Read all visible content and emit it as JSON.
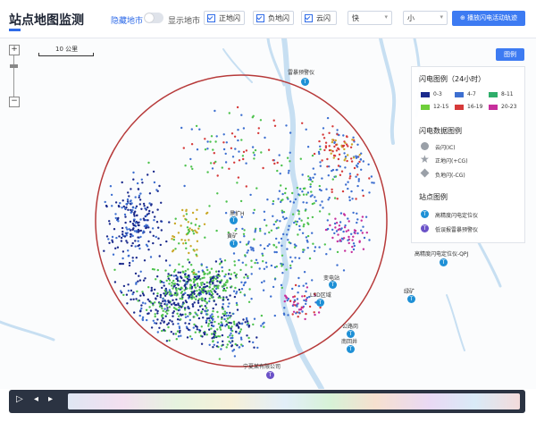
{
  "header": {
    "title": "站点地图监测",
    "hide_map_label": "隐藏地市",
    "show_map_label": "显示地市",
    "checkboxes": [
      {
        "label": "正地闪",
        "checked": true
      },
      {
        "label": "负地闪",
        "checked": true
      },
      {
        "label": "云闪",
        "checked": true
      }
    ],
    "select_speed": "快",
    "select_size": "小",
    "primary_button": "播放闪电活动轨迹"
  },
  "map": {
    "scale_label": "10 公里",
    "legend_button": "图例",
    "zoom_in": "+",
    "zoom_out": "−",
    "colors": {
      "circle": "#b73a3a",
      "navy": "#1b2a8c",
      "blue": "#3d6fd0",
      "green": "#4dc24d",
      "yellow": "#c9a827",
      "red": "#d63a3a",
      "magenta": "#c72f9c",
      "river": "#c7dff2"
    },
    "stations": [
      {
        "name": "雷暴预警仪",
        "pin": "T",
        "type": "blue"
      },
      {
        "name": "黑扩H",
        "pin": "T",
        "type": "blue"
      },
      {
        "name": "黄矿",
        "pin": "T",
        "type": "blue"
      },
      {
        "name": "变电站",
        "pin": "T",
        "type": "blue"
      },
      {
        "name": "LSD区域",
        "pin": "T",
        "type": "blue"
      },
      {
        "name": "公路岗",
        "pin": "T",
        "type": "blue"
      },
      {
        "name": "南回井",
        "pin": "T",
        "type": "blue"
      },
      {
        "name": "高精度闪电定位仪-QPJ",
        "pin": "T",
        "type": "blue"
      },
      {
        "name": "绿矿",
        "pin": "T",
        "type": "blue"
      },
      {
        "name": "宁夏某有限公司",
        "pin": "T",
        "type": "purple"
      }
    ]
  },
  "legend": {
    "title": "闪电图例（24小时）",
    "ranges": [
      {
        "label": "0-3",
        "color": "#1b2a8c"
      },
      {
        "label": "4-7",
        "color": "#3d6fd0"
      },
      {
        "label": "8-11",
        "color": "#2fae6a"
      },
      {
        "label": "12-15",
        "color": "#6fcf3a"
      },
      {
        "label": "16-19",
        "color": "#d63a3a"
      },
      {
        "label": "20-23",
        "color": "#c72f9c"
      }
    ],
    "data_title": "闪电数据图例",
    "data_items": [
      {
        "label": "云闪(IC)",
        "icon": "circle-icon"
      },
      {
        "label": "正地闪(+CG)",
        "icon": "star-icon"
      },
      {
        "label": "负地闪(-CG)",
        "icon": "diamond-icon"
      }
    ],
    "station_title": "站点图例",
    "station_items": [
      {
        "label": "高精度闪电定位仪",
        "icon": "station-icon"
      },
      {
        "label": "低误报雷暴预警仪",
        "icon": "warning-station-icon"
      }
    ]
  },
  "timeline": {
    "play_icon": "play-icon",
    "prev_icon": "prev-icon",
    "next_icon": "next-icon"
  }
}
